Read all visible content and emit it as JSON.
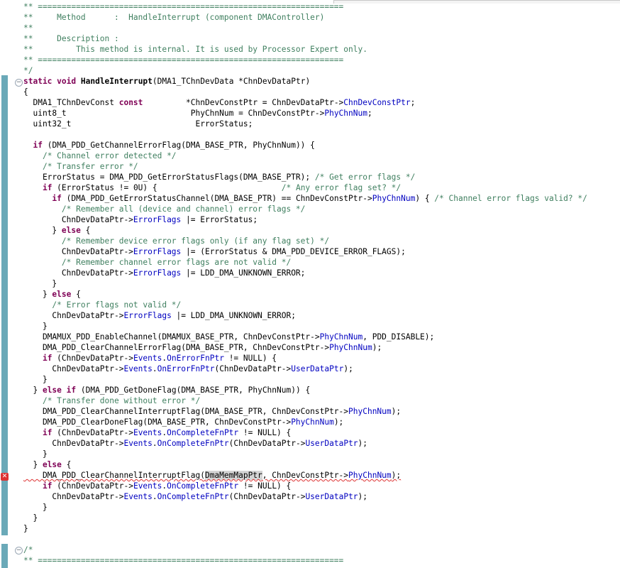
{
  "editor": {
    "lines": [
      [
        {
          "t": "** ================================================================",
          "c": "cm"
        }
      ],
      [
        {
          "t": "**     Method      :  HandleInterrupt (component DMAController)",
          "c": "cm"
        }
      ],
      [
        {
          "t": "**",
          "c": "cm"
        }
      ],
      [
        {
          "t": "**     Description :",
          "c": "cm"
        }
      ],
      [
        {
          "t": "**         This method is internal. It is used by Processor Expert only.",
          "c": "cm"
        }
      ],
      [
        {
          "t": "** ================================================================",
          "c": "cm"
        }
      ],
      [
        {
          "t": "*/",
          "c": "cm"
        }
      ],
      [
        {
          "t": "static",
          "c": "kw"
        },
        {
          "t": " "
        },
        {
          "t": "void",
          "c": "kw"
        },
        {
          "t": " "
        },
        {
          "t": "HandleInterrupt",
          "c": "bold"
        },
        {
          "t": "(DMA1_TChnDevData *ChnDevDataPtr)"
        }
      ],
      [
        {
          "t": "{"
        }
      ],
      [
        {
          "t": "  DMA1_TChnDevConst "
        },
        {
          "t": "const",
          "c": "kw"
        },
        {
          "t": "         *ChnDevConstPtr = ChnDevDataPtr->"
        },
        {
          "t": "ChnDevConstPtr",
          "c": "fld"
        },
        {
          "t": ";"
        }
      ],
      [
        {
          "t": "  uint8_t                          PhyChnNum = ChnDevConstPtr->"
        },
        {
          "t": "PhyChnNum",
          "c": "fld"
        },
        {
          "t": ";"
        }
      ],
      [
        {
          "t": "  uint32_t                          ErrorStatus;"
        }
      ],
      [
        {
          "t": ""
        }
      ],
      [
        {
          "t": "  "
        },
        {
          "t": "if",
          "c": "kw"
        },
        {
          "t": " (DMA_PDD_GetChannelErrorFlag(DMA_BASE_PTR, PhyChnNum)) {"
        }
      ],
      [
        {
          "t": "    "
        },
        {
          "t": "/* Channel error detected */",
          "c": "cm"
        }
      ],
      [
        {
          "t": "    "
        },
        {
          "t": "/* Transfer error */",
          "c": "cm"
        }
      ],
      [
        {
          "t": "    ErrorStatus = DMA_PDD_GetErrorStatusFlags(DMA_BASE_PTR); "
        },
        {
          "t": "/* Get error flags */",
          "c": "cm"
        }
      ],
      [
        {
          "t": "    "
        },
        {
          "t": "if",
          "c": "kw"
        },
        {
          "t": " (ErrorStatus != 0U) {                          "
        },
        {
          "t": "/* Any error flag set? */",
          "c": "cm"
        }
      ],
      [
        {
          "t": "      "
        },
        {
          "t": "if",
          "c": "kw"
        },
        {
          "t": " (DMA_PDD_GetErrorStatusChannel(DMA_BASE_PTR) == ChnDevConstPtr->"
        },
        {
          "t": "PhyChnNum",
          "c": "fld"
        },
        {
          "t": ") { "
        },
        {
          "t": "/* Channel error flags valid? */",
          "c": "cm"
        }
      ],
      [
        {
          "t": "        "
        },
        {
          "t": "/* Remember all (device and channel) error flags */",
          "c": "cm"
        }
      ],
      [
        {
          "t": "        ChnDevDataPtr->"
        },
        {
          "t": "ErrorFlags",
          "c": "fld"
        },
        {
          "t": " |= ErrorStatus;"
        }
      ],
      [
        {
          "t": "      } "
        },
        {
          "t": "else",
          "c": "kw"
        },
        {
          "t": " {"
        }
      ],
      [
        {
          "t": "        "
        },
        {
          "t": "/* Remember device error flags only (if any flag set) */",
          "c": "cm"
        }
      ],
      [
        {
          "t": "        ChnDevDataPtr->"
        },
        {
          "t": "ErrorFlags",
          "c": "fld"
        },
        {
          "t": " |= (ErrorStatus & DMA_PDD_DEVICE_ERROR_FLAGS);"
        }
      ],
      [
        {
          "t": "        "
        },
        {
          "t": "/* Remember channel error flags are not valid */",
          "c": "cm"
        }
      ],
      [
        {
          "t": "        ChnDevDataPtr->"
        },
        {
          "t": "ErrorFlags",
          "c": "fld"
        },
        {
          "t": " |= LDD_DMA_UNKNOWN_ERROR;"
        }
      ],
      [
        {
          "t": "      }"
        }
      ],
      [
        {
          "t": "    } "
        },
        {
          "t": "else",
          "c": "kw"
        },
        {
          "t": " {"
        }
      ],
      [
        {
          "t": "      "
        },
        {
          "t": "/* Error flags not valid */",
          "c": "cm"
        }
      ],
      [
        {
          "t": "      ChnDevDataPtr->"
        },
        {
          "t": "ErrorFlags",
          "c": "fld"
        },
        {
          "t": " |= LDD_DMA_UNKNOWN_ERROR;"
        }
      ],
      [
        {
          "t": "    }"
        }
      ],
      [
        {
          "t": "    DMAMUX_PDD_EnableChannel(DMAMUX_BASE_PTR, ChnDevConstPtr->"
        },
        {
          "t": "PhyChnNum",
          "c": "fld"
        },
        {
          "t": ", PDD_DISABLE);"
        }
      ],
      [
        {
          "t": "    DMA_PDD_ClearChannelErrorFlag(DMA_BASE_PTR, ChnDevConstPtr->"
        },
        {
          "t": "PhyChnNum",
          "c": "fld"
        },
        {
          "t": ");"
        }
      ],
      [
        {
          "t": "    "
        },
        {
          "t": "if",
          "c": "kw"
        },
        {
          "t": " (ChnDevDataPtr->"
        },
        {
          "t": "Events",
          "c": "fld"
        },
        {
          "t": "."
        },
        {
          "t": "OnErrorFnPtr",
          "c": "fld"
        },
        {
          "t": " != NULL) {"
        }
      ],
      [
        {
          "t": "      ChnDevDataPtr->"
        },
        {
          "t": "Events",
          "c": "fld"
        },
        {
          "t": "."
        },
        {
          "t": "OnErrorFnPtr",
          "c": "fld"
        },
        {
          "t": "(ChnDevDataPtr->"
        },
        {
          "t": "UserDataPtr",
          "c": "fld"
        },
        {
          "t": ");"
        }
      ],
      [
        {
          "t": "    }"
        }
      ],
      [
        {
          "t": "  } "
        },
        {
          "t": "else",
          "c": "kw"
        },
        {
          "t": " "
        },
        {
          "t": "if",
          "c": "kw"
        },
        {
          "t": " (DMA_PDD_GetDoneFlag(DMA_BASE_PTR, PhyChnNum)) {"
        }
      ],
      [
        {
          "t": "    "
        },
        {
          "t": "/* Transfer done without error */",
          "c": "cm"
        }
      ],
      [
        {
          "t": "    DMA_PDD_ClearChannelInterruptFlag(DMA_BASE_PTR, ChnDevConstPtr->"
        },
        {
          "t": "PhyChnNum",
          "c": "fld"
        },
        {
          "t": ");"
        }
      ],
      [
        {
          "t": "    DMA_PDD_ClearDoneFlag(DMA_BASE_PTR, ChnDevConstPtr->"
        },
        {
          "t": "PhyChnNum",
          "c": "fld"
        },
        {
          "t": ");"
        }
      ],
      [
        {
          "t": "    "
        },
        {
          "t": "if",
          "c": "kw"
        },
        {
          "t": " (ChnDevDataPtr->"
        },
        {
          "t": "Events",
          "c": "fld"
        },
        {
          "t": "."
        },
        {
          "t": "OnCompleteFnPtr",
          "c": "fld"
        },
        {
          "t": " != NULL) {"
        }
      ],
      [
        {
          "t": "      ChnDevDataPtr->"
        },
        {
          "t": "Events",
          "c": "fld"
        },
        {
          "t": "."
        },
        {
          "t": "OnCompleteFnPtr",
          "c": "fld"
        },
        {
          "t": "(ChnDevDataPtr->"
        },
        {
          "t": "UserDataPtr",
          "c": "fld"
        },
        {
          "t": ");"
        }
      ],
      [
        {
          "t": "    }"
        }
      ],
      [
        {
          "t": "  } "
        },
        {
          "t": "else",
          "c": "kw"
        },
        {
          "t": " {"
        }
      ],
      [
        {
          "t": "    DMA_PDD_ClearChannelInterruptFlag(",
          "c": "err"
        },
        {
          "t": "DmaMemMapPtr",
          "c": "err hl"
        },
        {
          "t": ", ChnDevConstPtr->",
          "c": "err"
        },
        {
          "t": "PhyChnNum",
          "c": "fld err"
        },
        {
          "t": ");",
          "c": "err"
        }
      ],
      [
        {
          "t": "    "
        },
        {
          "t": "if",
          "c": "kw"
        },
        {
          "t": " (ChnDevDataPtr->"
        },
        {
          "t": "Events",
          "c": "fld"
        },
        {
          "t": "."
        },
        {
          "t": "OnCompleteFnPtr",
          "c": "fld"
        },
        {
          "t": " != NULL) {"
        }
      ],
      [
        {
          "t": "      ChnDevDataPtr->"
        },
        {
          "t": "Events",
          "c": "fld"
        },
        {
          "t": "."
        },
        {
          "t": "OnCompleteFnPtr",
          "c": "fld"
        },
        {
          "t": "(ChnDevDataPtr->"
        },
        {
          "t": "UserDataPtr",
          "c": "fld"
        },
        {
          "t": ");"
        }
      ],
      [
        {
          "t": "    }"
        }
      ],
      [
        {
          "t": "  }"
        }
      ],
      [
        {
          "t": "}"
        }
      ],
      [
        {
          "t": ""
        }
      ],
      [
        {
          "t": "/*",
          "c": "cm"
        }
      ],
      [
        {
          "t": "** ================================================================",
          "c": "cm"
        }
      ]
    ]
  },
  "gutter": {
    "fold_glyph": "−",
    "error_glyph": "✕"
  },
  "colors": {
    "comment": "#3f7f5f",
    "keyword": "#7f0055",
    "field": "#0000c0",
    "change_bar": "#6aa9b8",
    "error": "#d33333"
  }
}
